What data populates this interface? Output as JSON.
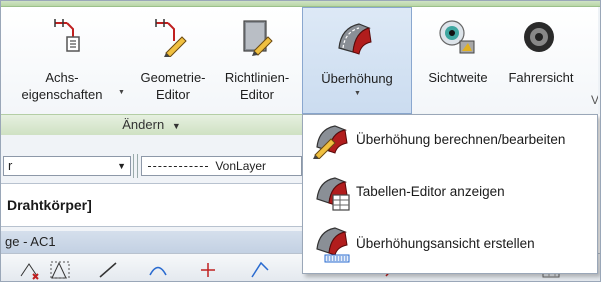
{
  "ribbon": {
    "buttons": [
      {
        "line1": "Achs-",
        "line2": "eigenschaften"
      },
      {
        "line1": "Geometrie-",
        "line2": "Editor"
      },
      {
        "line1": "Richtlinien-",
        "line2": "Editor"
      },
      {
        "line1": "Überhöhung",
        "line2": ""
      },
      {
        "line1": "Sichtweite",
        "line2": ""
      },
      {
        "line1": "Fahrersicht",
        "line2": ""
      }
    ],
    "panel_label": "Ändern",
    "panel_caret": "▼",
    "partial_label": "V"
  },
  "properties": {
    "layer_value": "r",
    "linetype_value": "VonLayer"
  },
  "command_line": {
    "text": "Drahtkörper]"
  },
  "document_tab": {
    "label": "ge - AC1"
  },
  "dropdown_menu": {
    "items": [
      {
        "label": "Überhöhung berechnen/bearbeiten"
      },
      {
        "label": "Tabellen-Editor anzeigen"
      },
      {
        "label": "Überhöhungsansicht erstellen"
      }
    ]
  },
  "colors": {
    "accent_selected": "#cbdcf0",
    "panel_green": "#cfe1c3"
  }
}
